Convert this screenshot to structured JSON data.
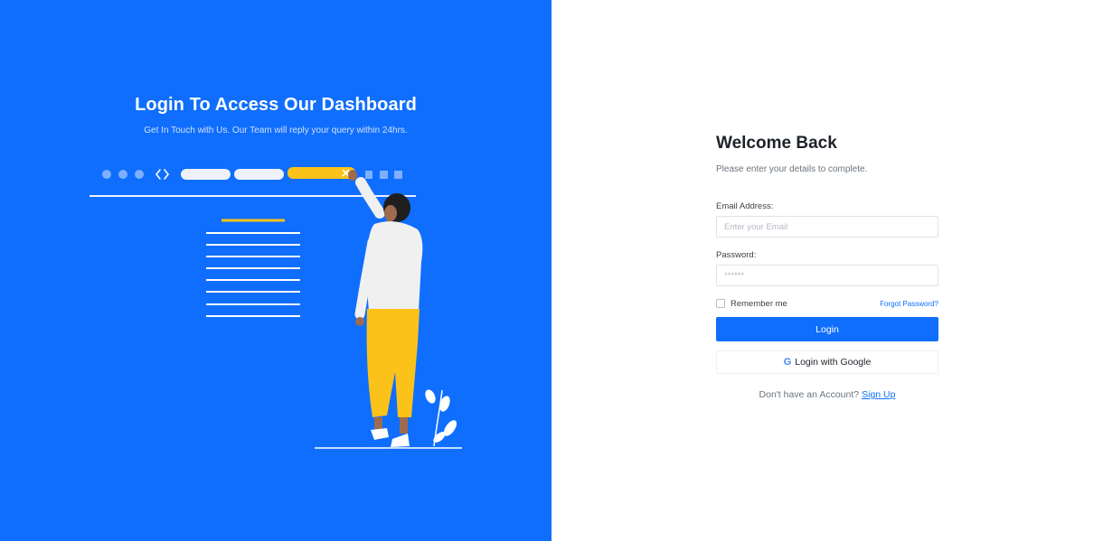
{
  "hero": {
    "title": "Login To Access Our Dashboard",
    "subtitle": "Get In Touch with Us. Our Team will reply your query within 24hrs.",
    "illustration_icon": "person-browser-illustration"
  },
  "form": {
    "heading": "Welcome Back",
    "subheading": "Please enter your details to complete.",
    "email_label": "Email Address:",
    "email_placeholder": "Enter your Email",
    "password_label": "Password:",
    "password_placeholder": "******",
    "remember_label": "Remember me",
    "remember_checked": false,
    "forgot_label": "Forgot Password?",
    "login_label": "Login",
    "google_icon_glyph": "G",
    "google_label": "Login with Google",
    "signup_prompt": "Don't have an Account?",
    "signup_link": "Sign Up"
  },
  "colors": {
    "primary": "#0f6efd",
    "accent_yellow": "#fbc21a",
    "text_dark": "#1e2228",
    "muted": "#6c757d"
  }
}
